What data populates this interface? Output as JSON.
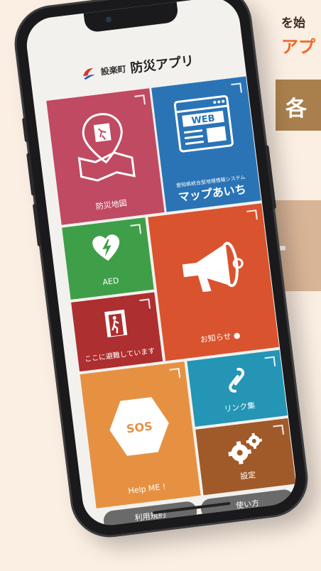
{
  "background": {
    "line1": "を始",
    "line2": "アプ",
    "band1_text": "各",
    "band2_text": "-"
  },
  "header": {
    "town": "設楽町",
    "title": "防災アプリ"
  },
  "tiles": {
    "map": {
      "label": "防災地図",
      "color": "#c04a62"
    },
    "web": {
      "icon_text": "WEB",
      "sub": "愛知県統合型地理情報システム",
      "label": "マップあいち",
      "color": "#2a74b6"
    },
    "aed": {
      "label": "AED",
      "color": "#3e9f48"
    },
    "shelter": {
      "label": "ここに避難しています",
      "color": "#ad2f2f"
    },
    "notice": {
      "label": "お知らせ ●",
      "color": "#d9532e"
    },
    "sos": {
      "icon_text": "SOS",
      "label": "Help ME !",
      "color": "#e69142"
    },
    "links": {
      "label": "リンク集",
      "color": "#2495b5"
    },
    "settings": {
      "label": "設定",
      "color": "#a05a2a"
    }
  },
  "bottom": {
    "terms": "利用規約",
    "howto": "使い方"
  }
}
